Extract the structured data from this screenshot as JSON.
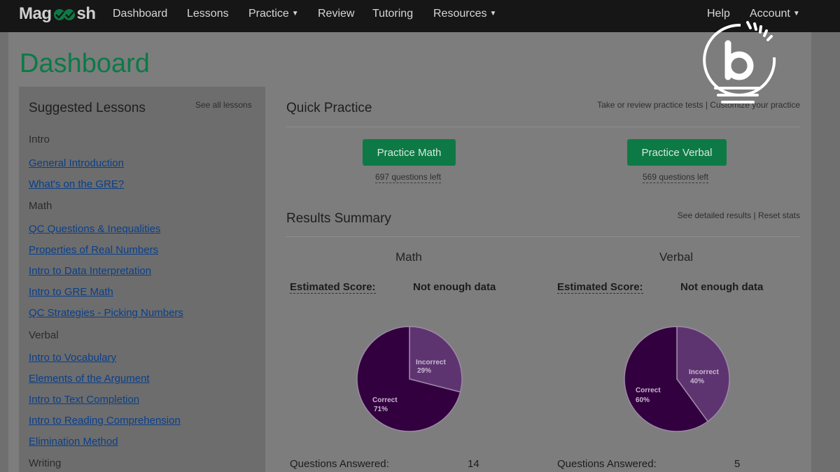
{
  "nav": {
    "brand_left": "Mag",
    "brand_right": "sh",
    "items": [
      {
        "label": "Dashboard",
        "caret": false
      },
      {
        "label": "Lessons",
        "caret": false
      },
      {
        "label": "Practice",
        "caret": true
      },
      {
        "label": "Review",
        "caret": false
      },
      {
        "label": "Tutoring",
        "caret": false
      },
      {
        "label": "Resources",
        "caret": true
      }
    ],
    "help": "Help",
    "account": "Account",
    "caret_glyph": "▼"
  },
  "page_title": "Dashboard",
  "sidebar": {
    "title": "Suggested Lessons",
    "see_all": "See all lessons",
    "lines": [
      {
        "type": "category",
        "text": "Intro"
      },
      {
        "type": "link",
        "text": "General Introduction"
      },
      {
        "type": "link",
        "text": "What's on the GRE?"
      },
      {
        "type": "category",
        "text": "Math"
      },
      {
        "type": "link",
        "text": "QC Questions & Inequalities"
      },
      {
        "type": "link",
        "text": "Properties of Real Numbers"
      },
      {
        "type": "link",
        "text": "Intro to Data Interpretation"
      },
      {
        "type": "link",
        "text": "Intro to GRE Math"
      },
      {
        "type": "link",
        "text": "QC Strategies - Picking Numbers"
      },
      {
        "type": "category",
        "text": "Verbal"
      },
      {
        "type": "link",
        "text": "Intro to Vocabulary"
      },
      {
        "type": "link",
        "text": "Elements of the Argument"
      },
      {
        "type": "link",
        "text": "Intro to Text Completion"
      },
      {
        "type": "link",
        "text": "Intro to Reading Comprehension"
      },
      {
        "type": "link",
        "text": "Elimination Method"
      },
      {
        "type": "category",
        "text": "Writing"
      }
    ]
  },
  "quick_practice": {
    "title": "Quick Practice",
    "links": "Take or review practice tests | Customize your practice",
    "math_button": "Practice Math",
    "math_left": "697 questions left",
    "verbal_button": "Practice Verbal",
    "verbal_left": "569 questions left"
  },
  "results": {
    "title": "Results Summary",
    "links": "See detailed results | Reset stats",
    "est_label": "Estimated Score:",
    "qa_label": "Questions Answered:",
    "math": {
      "title": "Math",
      "est_value": "Not enough data",
      "questions_answered": "14",
      "correct_label": "Correct",
      "correct_pct": "71%",
      "incorrect_label": "Incorrect",
      "incorrect_pct": "29%"
    },
    "verbal": {
      "title": "Verbal",
      "est_value": "Not enough data",
      "questions_answered": "5",
      "correct_label": "Correct",
      "correct_pct": "60%",
      "incorrect_label": "Incorrect",
      "incorrect_pct": "40%"
    }
  },
  "chart_data": [
    {
      "type": "pie",
      "title": "Math",
      "categories": [
        "Incorrect",
        "Correct"
      ],
      "values": [
        29,
        71
      ],
      "colors": [
        "#5e3470",
        "#33003f"
      ]
    },
    {
      "type": "pie",
      "title": "Verbal",
      "categories": [
        "Incorrect",
        "Correct"
      ],
      "values": [
        40,
        60
      ],
      "colors": [
        "#5e3470",
        "#33003f"
      ]
    }
  ],
  "colors": {
    "accent_green": "#0d7a45",
    "link_blue": "#0a3f8a",
    "pie_dark": "#33003f",
    "pie_light": "#5e3470"
  }
}
